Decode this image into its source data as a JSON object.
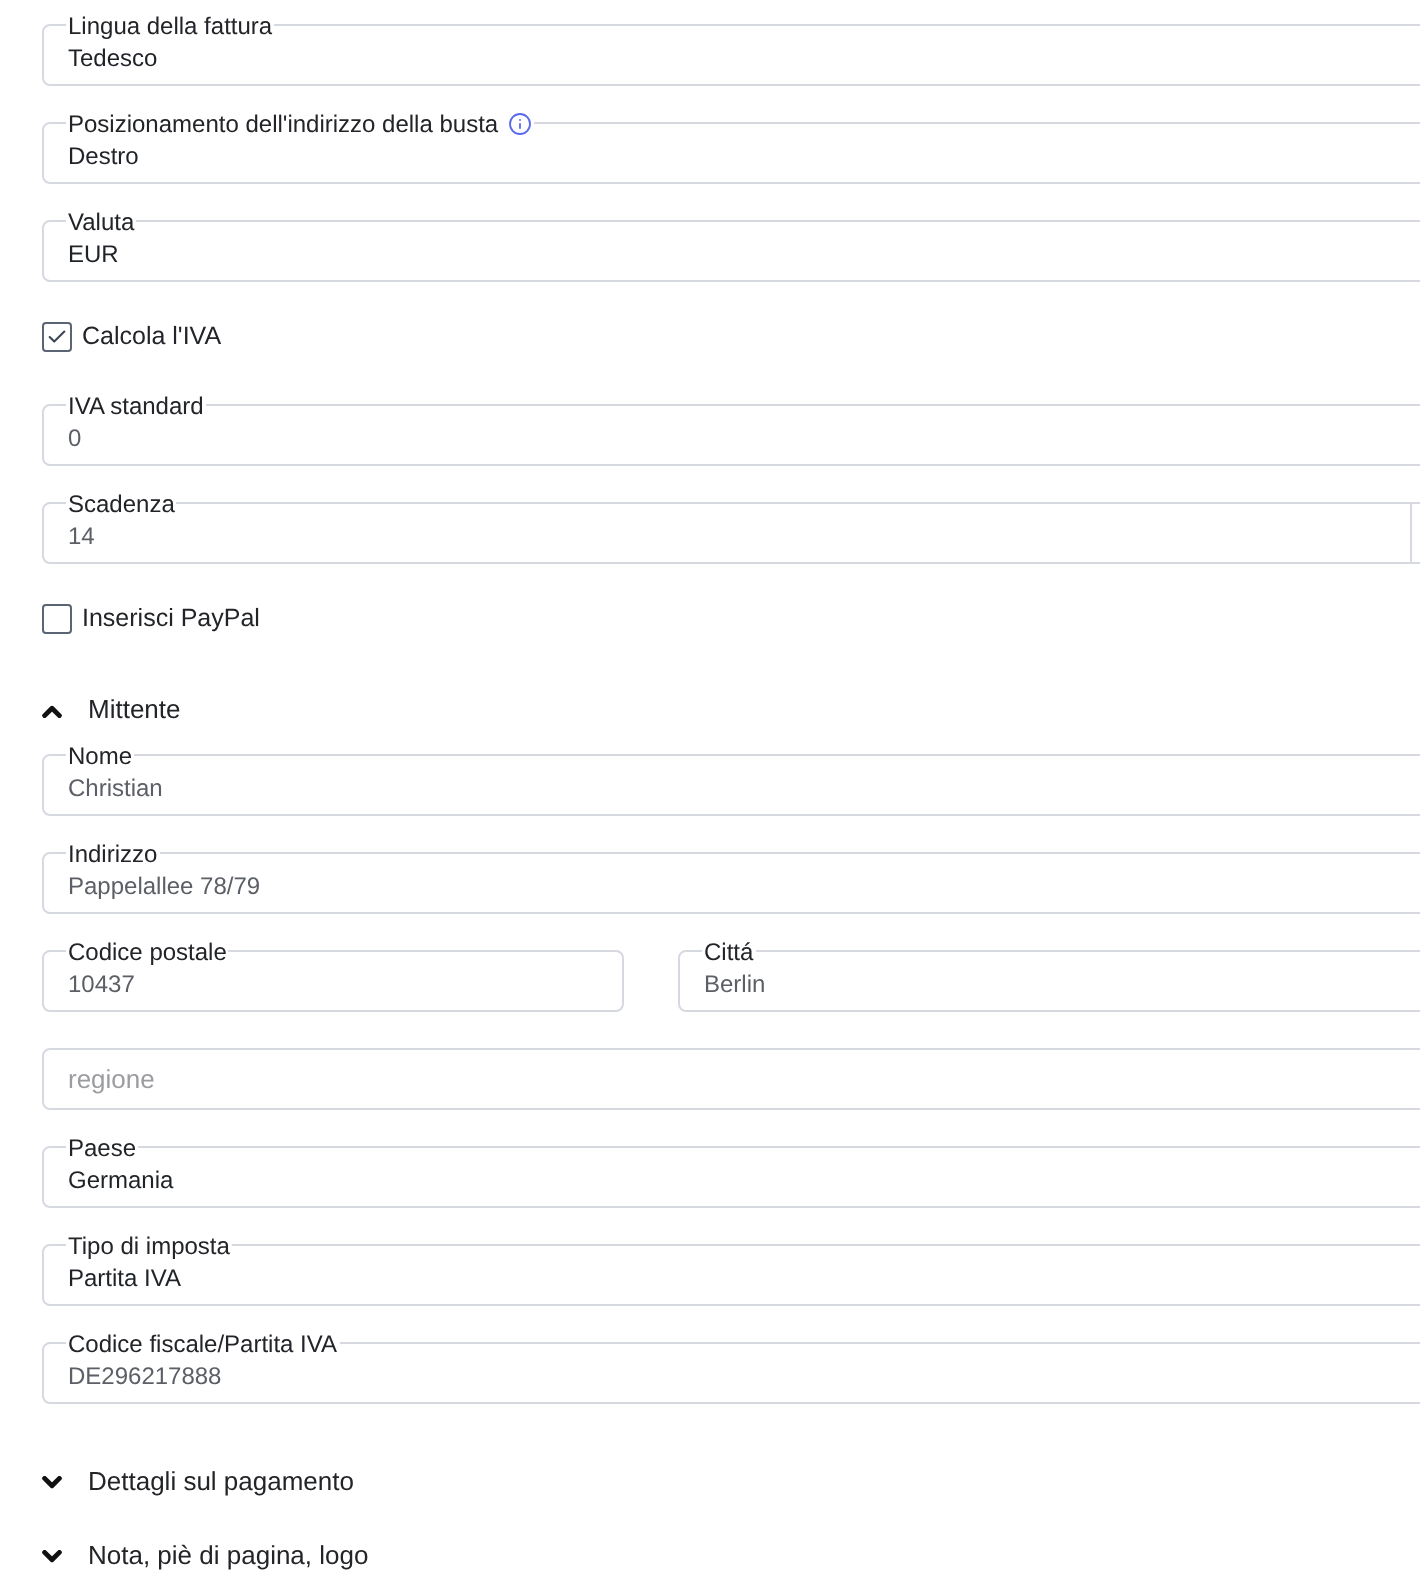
{
  "form": {
    "items": [
      {
        "kind": "select",
        "label": "Lingua della fattura",
        "value": "Tedesco"
      },
      {
        "kind": "select",
        "label": "Posizionamento dell'indirizzo della busta",
        "info": true,
        "value": "Destro"
      },
      {
        "kind": "select",
        "label": "Valuta",
        "value": "EUR"
      },
      {
        "kind": "checkbox",
        "label": "Calcola l'IVA",
        "checked": true
      },
      {
        "kind": "text",
        "label": "IVA standard",
        "value": "0"
      },
      {
        "kind": "text",
        "label": "Scadenza",
        "value": "14",
        "end_adornment": true
      },
      {
        "kind": "checkbox",
        "label": "Inserisci PayPal",
        "checked": false
      }
    ]
  },
  "sections": [
    {
      "title": "Mittente",
      "expanded": true,
      "items": [
        {
          "kind": "text",
          "label": "Nome",
          "value": "Christian"
        },
        {
          "kind": "text",
          "label": "Indirizzo",
          "value": "Pappelallee 78/79"
        },
        {
          "kind": "row",
          "fields": [
            {
              "kind": "text",
              "label": "Codice postale",
              "value": "10437"
            },
            {
              "kind": "text",
              "label": "Cittá",
              "value": "Berlin"
            }
          ]
        },
        {
          "kind": "text",
          "placeholder": "regione"
        },
        {
          "kind": "select",
          "label": "Paese",
          "value": "Germania"
        },
        {
          "kind": "select",
          "label": "Tipo di imposta",
          "value": "Partita IVA"
        },
        {
          "kind": "text",
          "label": "Codice fiscale/Partita IVA",
          "value": "DE296217888"
        }
      ]
    },
    {
      "title": "Dettagli sul pagamento",
      "expanded": false
    },
    {
      "title": "Nota, piè di pagina, logo",
      "expanded": false
    }
  ]
}
